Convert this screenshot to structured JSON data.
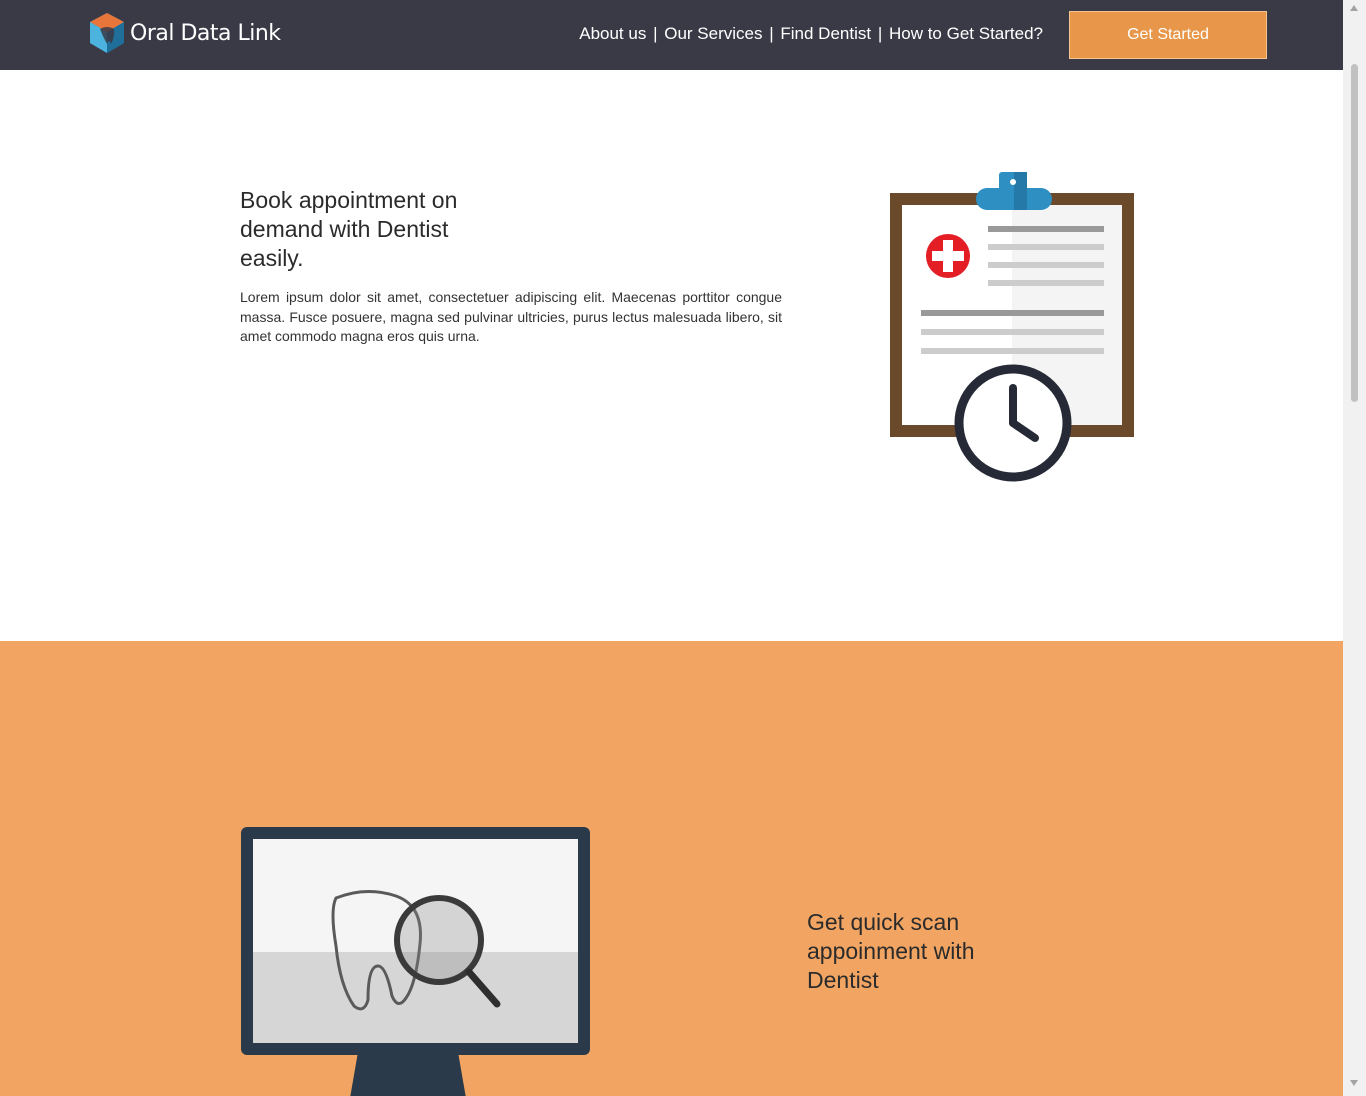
{
  "header": {
    "brand": "Oral Data Link",
    "nav": [
      {
        "label": "About us"
      },
      {
        "label": "Our Services"
      },
      {
        "label": "Find Dentist"
      },
      {
        "label": "How to Get Started?"
      }
    ],
    "nav_separator": "|",
    "cta_label": "Get Started"
  },
  "section1": {
    "title": "Book appointment on demand with Dentist easily.",
    "body": "Lorem ipsum dolor sit amet, consectetuer adipiscing elit. Maecenas porttitor congue massa. Fusce posuere, magna sed pulvinar ultricies, purus lectus malesuada libero, sit amet commodo magna eros quis urna.",
    "illustration_icon": "clipboard-clock-icon"
  },
  "section2": {
    "title": "Get quick scan appoinment with Dentist",
    "illustration_icon": "monitor-tooth-scan-icon"
  },
  "colors": {
    "header_bg": "#3a3a46",
    "accent": "#e8974a",
    "section2_bg": "#f2a563",
    "text_dark": "#2b2b2b"
  }
}
